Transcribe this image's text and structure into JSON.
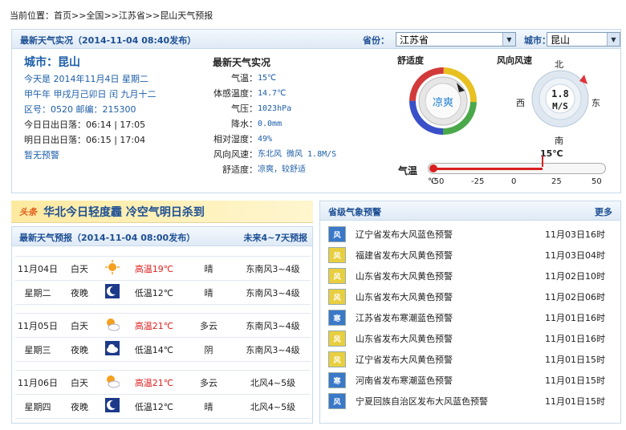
{
  "breadcrumb": {
    "prefix": "当前位置：",
    "home": "首页",
    "sep1": ">>",
    "country": "全国",
    "sep2": ">>",
    "province": "江苏省",
    "sep3": ">>",
    "current": "昆山天气预报"
  },
  "realtime": {
    "title": "最新天气实况（2014-11-04 08:40发布）",
    "province_label": "省份：",
    "province_value": "江苏省",
    "city_label": "城市：",
    "city_value": "昆山"
  },
  "city": {
    "name": "城市：昆山",
    "today": "今天是 2014年11月4日 星期二",
    "lunar": "甲午年 甲戌月己卯日 闰 九月十二",
    "codes": "区号：0520  邮编：215300",
    "sun_today": "今日日出日落：06:14 | 17:05",
    "sun_tomorrow": "明日日出日落：06:15 | 17:04",
    "alert": "暂无预警"
  },
  "obs": {
    "title": "最新天气实况",
    "rows": [
      {
        "k": "气温：",
        "v": "15℃"
      },
      {
        "k": "体感温度：",
        "v": "14.7℃"
      },
      {
        "k": "气压：",
        "v": "1023hPa"
      },
      {
        "k": "降水：",
        "v": "0.0mm"
      },
      {
        "k": "相对湿度：",
        "v": "49%"
      },
      {
        "k": "风向风速：",
        "v": "东北风 微风 1.8M/S"
      },
      {
        "k": "舒适度：",
        "v": "凉爽，较舒适"
      }
    ]
  },
  "comfort": {
    "title": "舒适度",
    "value": "凉爽"
  },
  "wind": {
    "title": "风向风速",
    "speed": "1.8",
    "unit": "M/S",
    "n": "北",
    "s": "南",
    "e": "东",
    "w": "西"
  },
  "temp": {
    "label": "气温",
    "value_label": "15℃",
    "value": 15,
    "min": -50,
    "max": 50,
    "ticks": [
      "℃",
      "-50",
      "-25",
      "0",
      "25",
      "50"
    ]
  },
  "headline": {
    "tag": "头条",
    "text": "华北今日轻度霾 冷空气明日杀到"
  },
  "forecast": {
    "title": "最新天气预报（2014-11-04 08:00发布）",
    "more": "未来4~7天预报",
    "days": [
      {
        "date": "11月04日",
        "week": "星期二",
        "rows": [
          {
            "period": "白天",
            "icon": "sun",
            "temp": "高温19℃",
            "wx": "晴",
            "wind": "东南风3~4级",
            "hot": true
          },
          {
            "period": "夜晚",
            "icon": "moon",
            "temp": "低温12℃",
            "wx": "晴",
            "wind": "东南风3~4级",
            "hot": false
          }
        ]
      },
      {
        "date": "11月05日",
        "week": "星期三",
        "rows": [
          {
            "period": "白天",
            "icon": "suncloud",
            "temp": "高温21℃",
            "wx": "多云",
            "wind": "东南风3~4级",
            "hot": true
          },
          {
            "period": "夜晚",
            "icon": "cloud",
            "temp": "低温14℃",
            "wx": "阴",
            "wind": "东南风3~4级",
            "hot": false
          }
        ]
      },
      {
        "date": "11月06日",
        "week": "星期四",
        "rows": [
          {
            "period": "白天",
            "icon": "suncloud",
            "temp": "高温21℃",
            "wx": "多云",
            "wind": "北风4~5级",
            "hot": true
          },
          {
            "period": "夜晚",
            "icon": "moon",
            "temp": "低温12℃",
            "wx": "晴",
            "wind": "北风4~5级",
            "hot": false
          }
        ]
      }
    ]
  },
  "warnings": {
    "title": "省级气象预警",
    "more": "更多",
    "items": [
      {
        "text": "辽宁省发布大风蓝色预警",
        "time": "11月03日16时",
        "color": "#3a78c8",
        "icon": "flag-icon"
      },
      {
        "text": "福建省发布大风黄色预警",
        "time": "11月03日04时",
        "color": "#e8cf40",
        "icon": "flag-icon"
      },
      {
        "text": "山东省发布大风黄色预警",
        "time": "11月02日10时",
        "color": "#e8cf40",
        "icon": "flag-icon"
      },
      {
        "text": "山东省发布大风黄色预警",
        "time": "11月02日06时",
        "color": "#e8cf40",
        "icon": "flag-icon"
      },
      {
        "text": "江苏省发布寒潮蓝色预警",
        "time": "11月01日16时",
        "color": "#3a78c8",
        "icon": "thermometer-icon"
      },
      {
        "text": "山东省发布大风黄色预警",
        "time": "11月01日16时",
        "color": "#e8cf40",
        "icon": "flag-icon"
      },
      {
        "text": "辽宁省发布大风黄色预警",
        "time": "11月01日15时",
        "color": "#e8cf40",
        "icon": "flag-icon"
      },
      {
        "text": "河南省发布寒潮蓝色预警",
        "time": "11月01日15时",
        "color": "#3a78c8",
        "icon": "thermometer-icon"
      },
      {
        "text": "宁夏回族自治区发布大风蓝色预警",
        "time": "11月01日15时",
        "color": "#3a78c8",
        "icon": "flag-icon"
      }
    ]
  }
}
